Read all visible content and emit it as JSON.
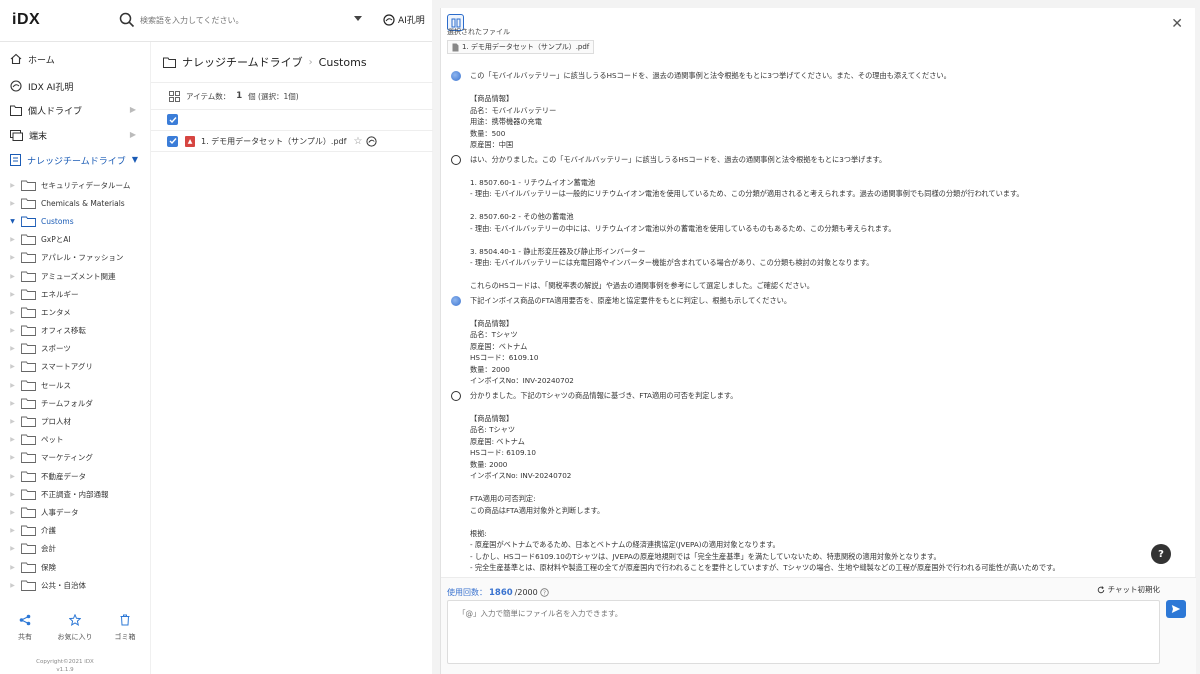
{
  "app": {
    "logo": "iDX"
  },
  "search": {
    "placeholder": "検索語を入力してください。"
  },
  "ai_button": {
    "label": "AI孔明"
  },
  "nav": [
    {
      "label": "ホーム",
      "icon": "home-icon"
    },
    {
      "label": "IDX AI孔明",
      "icon": "ai-icon"
    },
    {
      "label": "個人ドライブ",
      "icon": "folder-icon"
    },
    {
      "label": "端末",
      "icon": "device-icon"
    },
    {
      "label": "ナレッジチームドライブ",
      "icon": "team-drive-icon"
    }
  ],
  "tree": [
    "セキュリティデータルーム",
    "Chemicals & Materials",
    "Customs",
    "GxPとAI",
    "アパレル・ファッション",
    "アミューズメント関連",
    "エネルギー",
    "エンタメ",
    "オフィス移転",
    "スポーツ",
    "スマートアグリ",
    "セールス",
    "チームフォルダ",
    "プロ人材",
    "ペット",
    "マーケティング",
    "不動産データ",
    "不正調査・内部通報",
    "人事データ",
    "介護",
    "会計",
    "保険",
    "公共・自治体"
  ],
  "tree_active_index": 2,
  "bottom_actions": {
    "share": "共有",
    "favorite": "お気に入り",
    "trash": "ゴミ箱"
  },
  "copyright": {
    "line1": "Copyright©2021 iDX",
    "line2": "v1.1.9"
  },
  "filearea": {
    "breadcrumb_root": "ナレッジチームドライブ",
    "breadcrumb_current": "Customs",
    "count_label": "アイテム数：",
    "count_value": "1",
    "count_unit": "個 (選択：1個)",
    "file_name": "1. デモ用データセット（サンプル）.pdf"
  },
  "chat": {
    "selected_label": "選択されたファイル",
    "selected_file": "1. デモ用データセット（サンプル）.pdf",
    "messages": [
      {
        "role": "user",
        "text": "この「モバイルバッテリー」に該当しうるHSコードを、過去の通関事例と法令根拠をもとに3つ挙げてください。また、その理由も添えてください。\n\n【商品情報】\n品名：モバイルバッテリー\n用途：携帯機器の充電\n数量：500\n原産国：中国"
      },
      {
        "role": "ai",
        "text": "はい、分かりました。この「モバイルバッテリー」に該当しうるHSコードを、過去の通関事例と法令根拠をもとに3つ挙げます。\n\n1. 8507.60-1 - リチウムイオン蓄電池\n- 理由: モバイルバッテリーは一般的にリチウムイオン電池を使用しているため、この分類が適用されると考えられます。過去の通関事例でも同様の分類が行われています。\n\n2. 8507.60-2 - その他の蓄電池\n- 理由: モバイルバッテリーの中には、リチウムイオン電池以外の蓄電池を使用しているものもあるため、この分類も考えられます。\n\n3. 8504.40-1 - 静止形変圧器及び静止形インバーター\n- 理由: モバイルバッテリーには充電回路やインバーター機能が含まれている場合があり、この分類も検討の対象となります。\n\nこれらのHSコードは、「関税率表の解説」や過去の通関事例を参考にして選定しました。ご確認ください。"
      },
      {
        "role": "user",
        "text": "下記インボイス商品のFTA適用要否を、原産地と協定要件をもとに判定し、根拠も示してください。\n\n【商品情報】\n品名：Tシャツ\n原産国：ベトナム\nHSコード：6109.10\n数量：2000\nインボイスNo：INV-20240702"
      },
      {
        "role": "ai",
        "text": "分かりました。下記のTシャツの商品情報に基づき、FTA適用の可否を判定します。\n\n【商品情報】\n品名: Tシャツ\n原産国: ベトナム\nHSコード: 6109.10\n数量: 2000\nインボイスNo: INV-20240702\n\nFTA適用の可否判定:\nこの商品はFTA適用対象外と判断します。\n\n根拠:\n- 原産国がベトナムであるため、日本とベトナムの経済連携協定(JVEPA)の適用対象となります。\n- しかし、HSコード6109.10のTシャツは、JVEPAの原産地規則では「完全生産基準」を満たしていないため、特恵関税の適用対象外となります。\n- 完全生産基準とは、原材料や製造工程の全てが原産国内で行われることを要件としていますが、Tシャツの場合、生地や縫製などの工程が原産国外で行われる可能性が高いためです。"
      }
    ],
    "usage_label": "使用回数：",
    "usage_value": "1860",
    "usage_max": "/2000",
    "reset_label": "チャット初期化",
    "input_placeholder": "「@」入力で簡単にファイル名を入力できます。"
  },
  "colors": {
    "accent": "#2d78d6",
    "active_nav": "#1a5bb5",
    "pdf_red": "#d64541"
  }
}
